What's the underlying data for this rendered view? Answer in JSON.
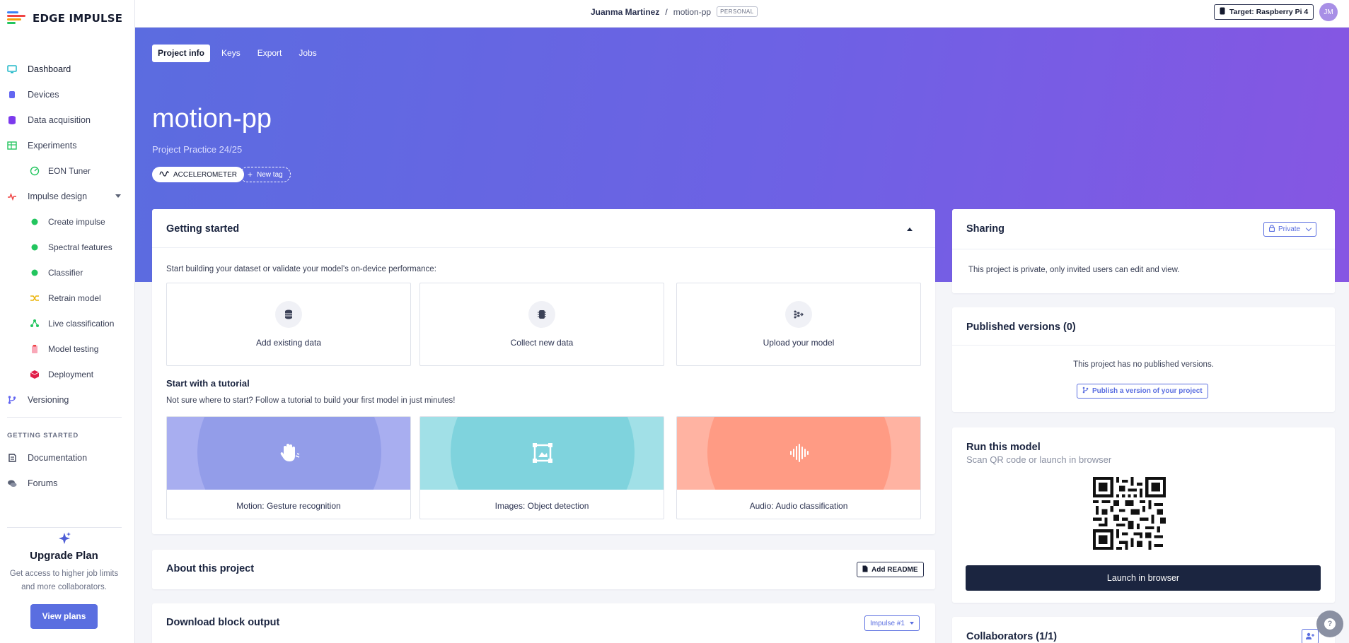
{
  "app": {
    "logo_text": "EDGE IMPULSE"
  },
  "sidebar": {
    "items": [
      {
        "label": "Dashboard"
      },
      {
        "label": "Devices"
      },
      {
        "label": "Data acquisition"
      },
      {
        "label": "Experiments"
      },
      {
        "label": "EON Tuner"
      },
      {
        "label": "Impulse design"
      },
      {
        "label": "Create impulse"
      },
      {
        "label": "Spectral features"
      },
      {
        "label": "Classifier"
      },
      {
        "label": "Retrain model"
      },
      {
        "label": "Live classification"
      },
      {
        "label": "Model testing"
      },
      {
        "label": "Deployment"
      },
      {
        "label": "Versioning"
      }
    ],
    "section_heading": "GETTING STARTED",
    "getting_started": [
      {
        "label": "Documentation"
      },
      {
        "label": "Forums"
      }
    ],
    "upgrade": {
      "title": "Upgrade Plan",
      "description": "Get access to higher job limits and more collaborators.",
      "button": "View plans"
    }
  },
  "topbar": {
    "owner": "Juanma Martinez",
    "separator": "/",
    "project": "motion-pp",
    "badge": "PERSONAL",
    "target": "Target: Raspberry Pi 4",
    "avatar_initials": "JM"
  },
  "hero": {
    "tabs": [
      "Project info",
      "Keys",
      "Export",
      "Jobs"
    ],
    "title": "motion-pp",
    "subtitle": "Project Practice 24/25",
    "tag": "ACCELEROMETER",
    "new_tag": "New tag"
  },
  "getting_started": {
    "title": "Getting started",
    "intro": "Start building your dataset or validate your model's on-device performance:",
    "options": [
      {
        "label": "Add existing data",
        "icon": "database-icon"
      },
      {
        "label": "Collect new data",
        "icon": "chip-icon"
      },
      {
        "label": "Upload your model",
        "icon": "model-upload-icon"
      }
    ],
    "tutorial_title": "Start with a tutorial",
    "tutorial_desc": "Not sure where to start? Follow a tutorial to build your first model in just minutes!",
    "tutorials": [
      {
        "label": "Motion: Gesture recognition",
        "icon": "hand-icon",
        "color": "#9aa2ec"
      },
      {
        "label": "Images: Object detection",
        "icon": "frame-icon",
        "color": "#8ad6df"
      },
      {
        "label": "Audio: Audio classification",
        "icon": "waveform-icon",
        "color": "#ff9c85"
      }
    ]
  },
  "about": {
    "title": "About this project",
    "button": "Add README"
  },
  "download": {
    "title": "Download block output",
    "selector": "Impulse #1"
  },
  "sharing": {
    "title": "Sharing",
    "visibility": "Private",
    "text": "This project is private, only invited users can edit and view."
  },
  "published": {
    "title": "Published versions (0)",
    "empty": "This project has no published versions.",
    "button": "Publish a version of your project"
  },
  "run_model": {
    "title": "Run this model",
    "subtitle": "Scan QR code or launch in browser",
    "button": "Launch in browser"
  },
  "collaborators": {
    "title": "Collaborators (1/1)"
  },
  "colors": {
    "accent": "#5a6ee0",
    "hero_start": "#5b6ce0",
    "hero_end": "#8656e3",
    "dark": "#1b2540"
  }
}
